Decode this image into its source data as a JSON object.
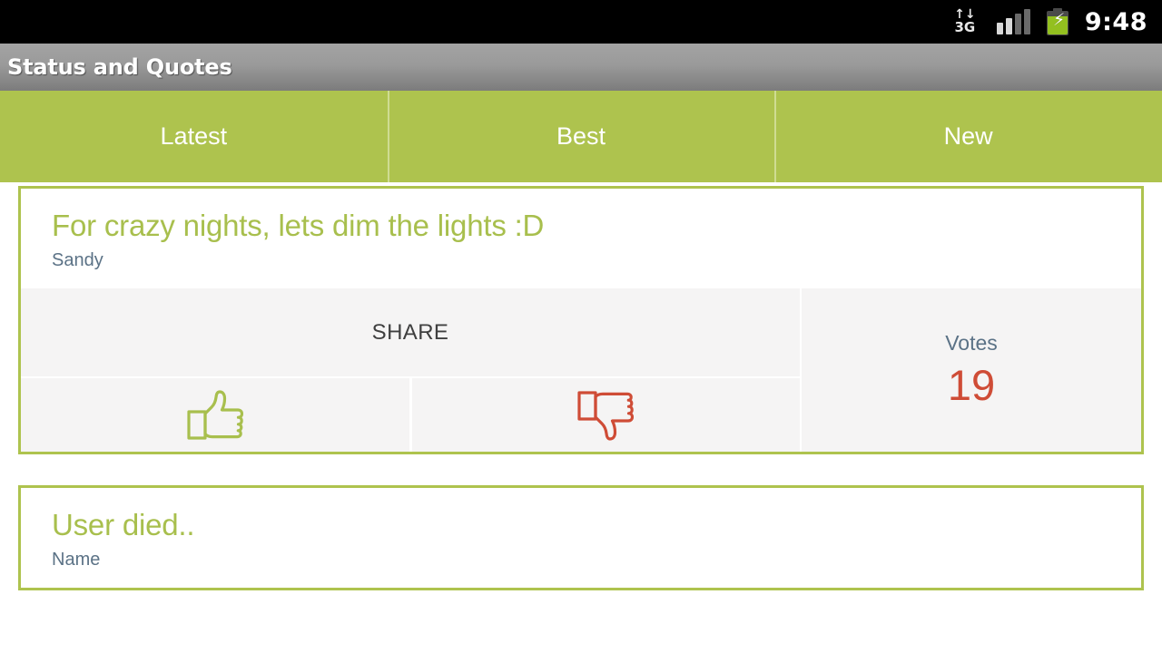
{
  "status_bar": {
    "network_label": "3G",
    "network_arrows": "↑↓",
    "clock": "9:48",
    "icons": {
      "network": "3g-data-icon",
      "signal": "signal-bars-icon",
      "battery": "battery-charging-icon"
    },
    "signal_bars_active": 2,
    "signal_bars_total": 4,
    "battery_charging": true
  },
  "title_bar": {
    "title": "Status and Quotes"
  },
  "tabs": {
    "selected_index": 0,
    "items": [
      {
        "label": "Latest"
      },
      {
        "label": "Best"
      },
      {
        "label": "New"
      }
    ]
  },
  "cards": [
    {
      "title": "For crazy nights, lets dim the lights :D",
      "author": "Sandy",
      "share_label": "SHARE",
      "votes_label": "Votes",
      "votes_count": "19",
      "thumbs_up_icon": "thumbs-up-icon",
      "thumbs_down_icon": "thumbs-down-icon"
    },
    {
      "title": "User died..",
      "author": "Name"
    }
  ],
  "colors": {
    "accent_green": "#aec34e",
    "title_green": "#a8bf4d",
    "author_slate": "#5b7286",
    "votes_red": "#cf4c36",
    "panel_gray": "#f5f4f4",
    "battery_green": "#93c01f",
    "status_bar_black": "#000000",
    "title_bar_gray": "#9a9a9a"
  }
}
